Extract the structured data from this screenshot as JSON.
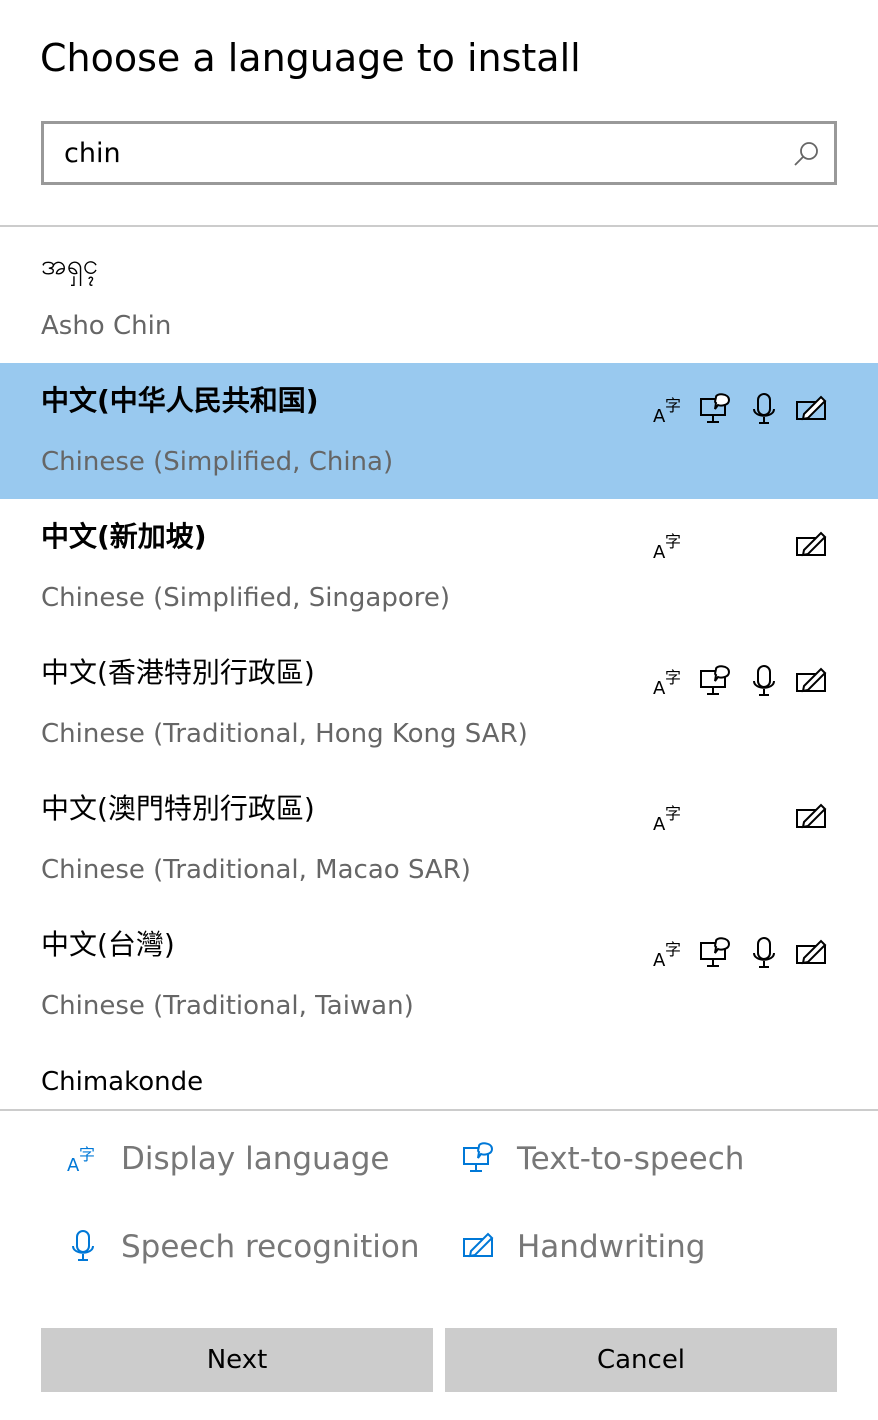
{
  "dialog": {
    "title": "Choose a language to install"
  },
  "search": {
    "value": "chin",
    "icon": "search-icon"
  },
  "languages": [
    {
      "native": "အရှၚ",
      "english": "Asho Chin",
      "selected": false,
      "features": {
        "display": false,
        "tts": false,
        "speech": false,
        "handwriting": false
      }
    },
    {
      "native": "中文(中华人民共和国)",
      "english": "Chinese (Simplified, China)",
      "selected": true,
      "features": {
        "display": true,
        "tts": true,
        "speech": true,
        "handwriting": true
      }
    },
    {
      "native": "中文(新加坡)",
      "english": "Chinese (Simplified, Singapore)",
      "selected": false,
      "features": {
        "display": true,
        "tts": false,
        "speech": false,
        "handwriting": true
      }
    },
    {
      "native": "中文(香港特別行政區)",
      "english": "Chinese (Traditional, Hong Kong SAR)",
      "selected": false,
      "features": {
        "display": true,
        "tts": true,
        "speech": true,
        "handwriting": true
      }
    },
    {
      "native": "中文(澳門特別行政區)",
      "english": "Chinese (Traditional, Macao SAR)",
      "selected": false,
      "features": {
        "display": true,
        "tts": false,
        "speech": false,
        "handwriting": true
      }
    },
    {
      "native": "中文(台灣)",
      "english": "Chinese (Traditional, Taiwan)",
      "selected": false,
      "features": {
        "display": true,
        "tts": true,
        "speech": true,
        "handwriting": true
      }
    }
  ],
  "partial_item": {
    "native": "Chimakonde"
  },
  "legend": {
    "display": "Display language",
    "tts": "Text-to-speech",
    "speech": "Speech recognition",
    "handwriting": "Handwriting"
  },
  "buttons": {
    "next": "Next",
    "cancel": "Cancel"
  },
  "colors": {
    "selected_row": "#99c9ef",
    "legend_icon": "#0078d7",
    "button_bg": "#cccccc",
    "secondary_text": "#666666"
  }
}
